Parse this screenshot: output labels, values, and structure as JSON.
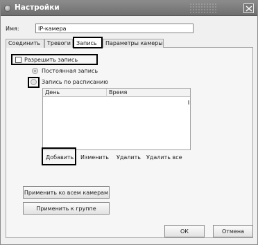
{
  "window": {
    "title": "Настройки"
  },
  "name_field": {
    "label": "Имя:",
    "value": "IP-камера"
  },
  "tabs": [
    {
      "label": "Соединить"
    },
    {
      "label": "Тревоги"
    },
    {
      "label": "Запись"
    },
    {
      "label": "Параметры камеры"
    }
  ],
  "recording": {
    "allow_label": "Разрешить запись",
    "allow_checked": false,
    "mode_constant": "Постоянная запись",
    "mode_schedule": "Запись по расписанию"
  },
  "schedule_table": {
    "columns": [
      "День",
      "Время"
    ],
    "rows": []
  },
  "schedule_buttons": {
    "add": "Добавить",
    "edit": "Изменить",
    "delete": "Удалить",
    "delete_all": "Удалить все"
  },
  "apply_buttons": {
    "all_cameras": "Применить ко всем камерам",
    "group": "Применить к группе"
  },
  "dialog_buttons": {
    "ok": "ОК",
    "cancel": "Отмена"
  }
}
